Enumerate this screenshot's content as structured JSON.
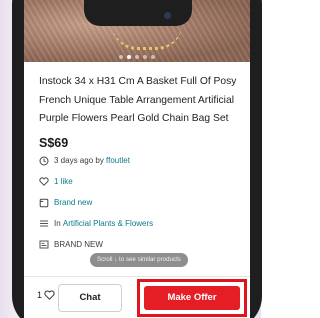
{
  "listing": {
    "title": "Instock 34 x H31 Cm A Basket Full Of Posy French Unique Table Arrangement Artificial Purple Flowers Pearl Gold Chain Bag Set",
    "price": "S$69",
    "posted_prefix": "3 days ago by",
    "seller": "ffoutlet",
    "likes_label": "1 like",
    "condition": "Brand new",
    "category_prefix": "In",
    "category": "Artificial Plants & Flowers",
    "brand_label": "BRAND NEW"
  },
  "gallery": {
    "image_count": 5,
    "active_index": 1
  },
  "toast": "Scroll ↓ to see similar products",
  "bottom_bar": {
    "like_count": "1",
    "chat_label": "Chat",
    "offer_label": "Make Offer"
  },
  "colors": {
    "accent_red": "#e51d25",
    "highlight_outline": "#e1131b",
    "link_teal": "#0b7a8a"
  },
  "icons": [
    "clock-icon",
    "heart-icon",
    "tag-icon",
    "menu-lines-icon",
    "brand-icon",
    "heart-outline-icon"
  ]
}
